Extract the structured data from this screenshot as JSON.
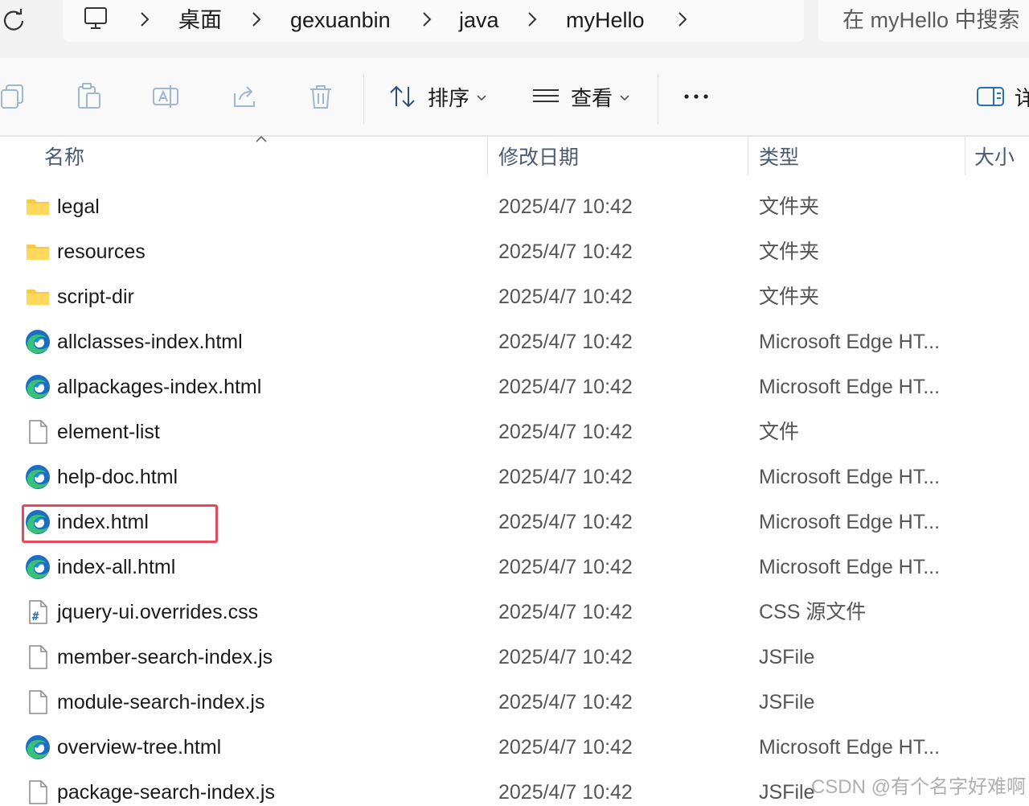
{
  "breadcrumb": {
    "items": [
      "桌面",
      "gexuanbin",
      "java",
      "myHello"
    ]
  },
  "search": {
    "placeholder": "在 myHello 中搜索"
  },
  "toolbar": {
    "sort_label": "排序",
    "view_label": "查看",
    "details_label": "详"
  },
  "columns": {
    "name": "名称",
    "modified": "修改日期",
    "type": "类型",
    "size": "大小"
  },
  "files": [
    {
      "name": "legal",
      "modified": "2025/4/7 10:42",
      "type": "文件夹",
      "icon": "folder-icon"
    },
    {
      "name": "resources",
      "modified": "2025/4/7 10:42",
      "type": "文件夹",
      "icon": "folder-icon"
    },
    {
      "name": "script-dir",
      "modified": "2025/4/7 10:42",
      "type": "文件夹",
      "icon": "folder-icon"
    },
    {
      "name": "allclasses-index.html",
      "modified": "2025/4/7 10:42",
      "type": "Microsoft Edge HT...",
      "icon": "edge-icon"
    },
    {
      "name": "allpackages-index.html",
      "modified": "2025/4/7 10:42",
      "type": "Microsoft Edge HT...",
      "icon": "edge-icon"
    },
    {
      "name": "element-list",
      "modified": "2025/4/7 10:42",
      "type": "文件",
      "icon": "file-icon"
    },
    {
      "name": "help-doc.html",
      "modified": "2025/4/7 10:42",
      "type": "Microsoft Edge HT...",
      "icon": "edge-icon"
    },
    {
      "name": "index.html",
      "modified": "2025/4/7 10:42",
      "type": "Microsoft Edge HT...",
      "icon": "edge-icon"
    },
    {
      "name": "index-all.html",
      "modified": "2025/4/7 10:42",
      "type": "Microsoft Edge HT...",
      "icon": "edge-icon"
    },
    {
      "name": "jquery-ui.overrides.css",
      "modified": "2025/4/7 10:42",
      "type": "CSS 源文件",
      "icon": "css-file-icon"
    },
    {
      "name": "member-search-index.js",
      "modified": "2025/4/7 10:42",
      "type": "JSFile",
      "icon": "file-icon"
    },
    {
      "name": "module-search-index.js",
      "modified": "2025/4/7 10:42",
      "type": "JSFile",
      "icon": "file-icon"
    },
    {
      "name": "overview-tree.html",
      "modified": "2025/4/7 10:42",
      "type": "Microsoft Edge HT...",
      "icon": "edge-icon"
    },
    {
      "name": "package-search-index.js",
      "modified": "2025/4/7 10:42",
      "type": "JSFile",
      "icon": "file-icon"
    }
  ],
  "highlighted_file": "index.html",
  "watermark": "CSDN @有个名字好难啊",
  "colors": {
    "highlight_border": "#e8475c",
    "folder": "#f7c948",
    "edge_blue": "#1b6ec2",
    "edge_green": "#37c27a"
  }
}
